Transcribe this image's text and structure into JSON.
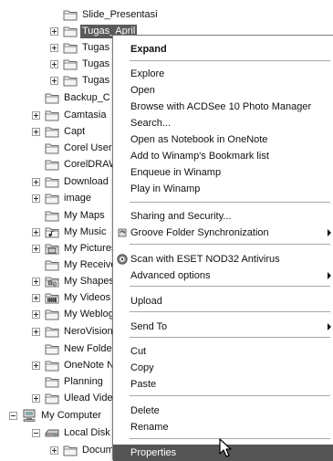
{
  "tree": {
    "nodes": [
      {
        "label": "Slide_Presentasi",
        "icon": "folder-icon",
        "expander": "none"
      },
      {
        "label": "Tugas_April",
        "icon": "folder-icon",
        "expander": "plus",
        "selected": true
      },
      {
        "label": "Tugas",
        "icon": "folder-icon",
        "expander": "plus"
      },
      {
        "label": "Tugas",
        "icon": "folder-icon",
        "expander": "plus"
      },
      {
        "label": "Tugas",
        "icon": "folder-icon",
        "expander": "plus"
      },
      {
        "label": "Backup_C",
        "icon": "folder-icon",
        "expander": "none"
      },
      {
        "label": "Camtasia",
        "icon": "folder-icon",
        "expander": "plus"
      },
      {
        "label": "Capt",
        "icon": "folder-icon",
        "expander": "plus"
      },
      {
        "label": "Corel User",
        "icon": "folder-icon",
        "expander": "none"
      },
      {
        "label": "CorelDRAW",
        "icon": "folder-icon",
        "expander": "none"
      },
      {
        "label": "Download",
        "icon": "folder-icon",
        "expander": "plus"
      },
      {
        "label": "image",
        "icon": "folder-icon",
        "expander": "plus"
      },
      {
        "label": "My Maps",
        "icon": "folder-icon",
        "expander": "none"
      },
      {
        "label": "My Music",
        "icon": "music-folder-icon",
        "expander": "plus"
      },
      {
        "label": "My Pictures",
        "icon": "pictures-folder-icon",
        "expander": "plus"
      },
      {
        "label": "My Received",
        "icon": "folder-icon",
        "expander": "none"
      },
      {
        "label": "My Shapes",
        "icon": "shapes-folder-icon",
        "expander": "plus"
      },
      {
        "label": "My Videos",
        "icon": "video-folder-icon",
        "expander": "plus"
      },
      {
        "label": "My Weblog",
        "icon": "folder-icon",
        "expander": "plus"
      },
      {
        "label": "NeroVision",
        "icon": "folder-icon",
        "expander": "plus"
      },
      {
        "label": "New Folder",
        "icon": "folder-icon",
        "expander": "none"
      },
      {
        "label": "OneNote N",
        "icon": "folder-icon",
        "expander": "plus"
      },
      {
        "label": "Planning",
        "icon": "folder-icon",
        "expander": "none"
      },
      {
        "label": "Ulead Vide",
        "icon": "folder-icon",
        "expander": "plus"
      },
      {
        "label": "My Computer",
        "icon": "computer-icon",
        "expander": "minus"
      },
      {
        "label": "Local Disk",
        "icon": "disk-icon",
        "expander": "minus"
      },
      {
        "label": "Docum",
        "icon": "folder-icon",
        "expander": "plus"
      }
    ]
  },
  "context_menu": {
    "items": [
      {
        "type": "item",
        "label": "Expand",
        "bold": true
      },
      {
        "type": "separator"
      },
      {
        "type": "item",
        "label": "Explore"
      },
      {
        "type": "item",
        "label": "Open"
      },
      {
        "type": "item",
        "label": "Browse with ACDSee 10 Photo Manager"
      },
      {
        "type": "item",
        "label": "Search..."
      },
      {
        "type": "item",
        "label": "Open as Notebook in OneNote"
      },
      {
        "type": "item",
        "label": "Add to Winamp's Bookmark list"
      },
      {
        "type": "item",
        "label": "Enqueue in Winamp"
      },
      {
        "type": "item",
        "label": "Play in Winamp"
      },
      {
        "type": "separator"
      },
      {
        "type": "item",
        "label": "Sharing and Security..."
      },
      {
        "type": "item",
        "label": "Groove Folder Synchronization",
        "submenu": true,
        "icon": "groove-icon"
      },
      {
        "type": "separator"
      },
      {
        "type": "item",
        "label": "Scan with ESET NOD32 Antivirus",
        "icon": "eset-icon"
      },
      {
        "type": "item",
        "label": "Advanced options",
        "submenu": true
      },
      {
        "type": "separator"
      },
      {
        "type": "item",
        "label": "Upload"
      },
      {
        "type": "separator"
      },
      {
        "type": "item",
        "label": "Send To",
        "submenu": true
      },
      {
        "type": "separator"
      },
      {
        "type": "item",
        "label": "Cut"
      },
      {
        "type": "item",
        "label": "Copy"
      },
      {
        "type": "item",
        "label": "Paste"
      },
      {
        "type": "separator"
      },
      {
        "type": "item",
        "label": "Delete"
      },
      {
        "type": "item",
        "label": "Rename"
      },
      {
        "type": "separator"
      },
      {
        "type": "item",
        "label": "Properties",
        "highlighted": true
      }
    ]
  },
  "colors": {
    "selection": "#5a5a5a",
    "menu_highlight": "#555555",
    "folder_fill": "#f4f4f4",
    "folder_stroke": "#6a6a6a"
  }
}
